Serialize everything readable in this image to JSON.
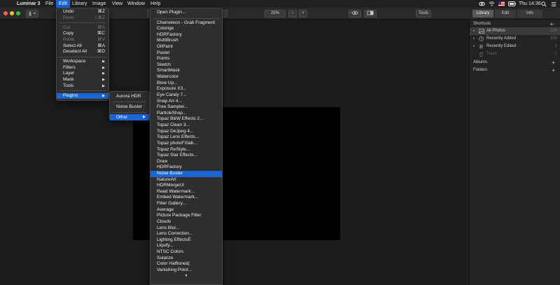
{
  "menubar": {
    "apple": "",
    "app_name": "Luminar 3",
    "items": [
      "File",
      "Edit",
      "Library",
      "Image",
      "View",
      "Window",
      "Help"
    ],
    "active": "Edit",
    "clock": "Thu 14:36"
  },
  "toolbar": {
    "zoom": "25%",
    "zoom_minus": "−",
    "zoom_plus": "+",
    "tools_label": "Tools",
    "tabs": [
      "Library",
      "Edit",
      "Info"
    ],
    "active_tab": "Library"
  },
  "panel": {
    "shortcuts_label": "Shortcuts",
    "shortcuts": [
      {
        "label": "All Photos",
        "count": "238"
      },
      {
        "label": "Recently Added",
        "count": "238"
      },
      {
        "label": "Recently Edited",
        "count": "1"
      },
      {
        "label": "Trash",
        "count": "0"
      }
    ],
    "albums_label": "Albums",
    "folders_label": "Folders"
  },
  "edit_menu": [
    {
      "label": "Undo",
      "shortcut": "⌘Z",
      "state": "normal"
    },
    {
      "label": "Redo",
      "shortcut": "⇧⌘Z",
      "state": "disabled"
    },
    {
      "sep": true
    },
    {
      "label": "Cut",
      "shortcut": "⌘X",
      "state": "disabled"
    },
    {
      "label": "Copy",
      "shortcut": "⌘C",
      "state": "normal"
    },
    {
      "label": "Paste",
      "shortcut": "⌘V",
      "state": "disabled"
    },
    {
      "label": "Select All",
      "shortcut": "⌘A",
      "state": "normal"
    },
    {
      "label": "Deselect All",
      "shortcut": "⌘D",
      "state": "normal"
    },
    {
      "sep": true
    },
    {
      "label": "Workspace",
      "submenu": true,
      "state": "normal"
    },
    {
      "label": "Filters",
      "submenu": true,
      "state": "normal"
    },
    {
      "label": "Layer",
      "submenu": true,
      "state": "normal"
    },
    {
      "label": "Mask",
      "submenu": true,
      "state": "normal"
    },
    {
      "label": "Tools",
      "submenu": true,
      "state": "normal"
    },
    {
      "sep": true
    },
    {
      "label": "Plugins",
      "submenu": true,
      "state": "highlighted"
    }
  ],
  "plugins_menu": [
    {
      "label": "Aurora HDR",
      "state": "normal"
    },
    {
      "sep": true
    },
    {
      "label": "Noise Buster",
      "state": "normal"
    },
    {
      "sep": true
    },
    {
      "label": "Other",
      "submenu": true,
      "state": "highlighted"
    }
  ],
  "other_menu": {
    "header": "Open Plugin...",
    "items": [
      "Chameleon - Grab Fragment",
      "Colorige",
      "HDRFactory",
      "MultiBrush",
      "OilPaint",
      "Pastel",
      "Points",
      "Sketch",
      "SmartMask",
      "Watercolor",
      "Blow Up...",
      "Exposure X3...",
      "Eye Candy 7...",
      "Snap Art 4...",
      "Free Sampler...",
      "ParticleShop...",
      "Topaz B&W Effects 2...",
      "Topaz Clean 3...",
      "Topaz DeJpeg 4...",
      "Topaz Lens Effects...",
      "Topaz photoFXlab...",
      "Topaz ReStyle...",
      "Topaz Star Effects...",
      "Draw",
      "HDRFactory",
      "Noise Buster",
      "NatureArt",
      "HDRMergeUI",
      "Read Watermark...",
      "Embed Watermark...",
      "Filter Gallery...",
      "Average",
      "Picture Package Filter",
      "Clouds",
      "Lens Blur...",
      "Lens Correction...",
      "Lighting EffectsÉ",
      "Liquify...",
      "NTSC Colors",
      "Solarize",
      "Color Halftoneâ¦",
      "Vanishing Point..."
    ],
    "highlighted": "Noise Buster",
    "more_arrow": "▼"
  },
  "colors": {
    "accent": "#1d64d4",
    "close": "#fe5f57",
    "minimize": "#febc2e",
    "zoom": "#28c840"
  }
}
